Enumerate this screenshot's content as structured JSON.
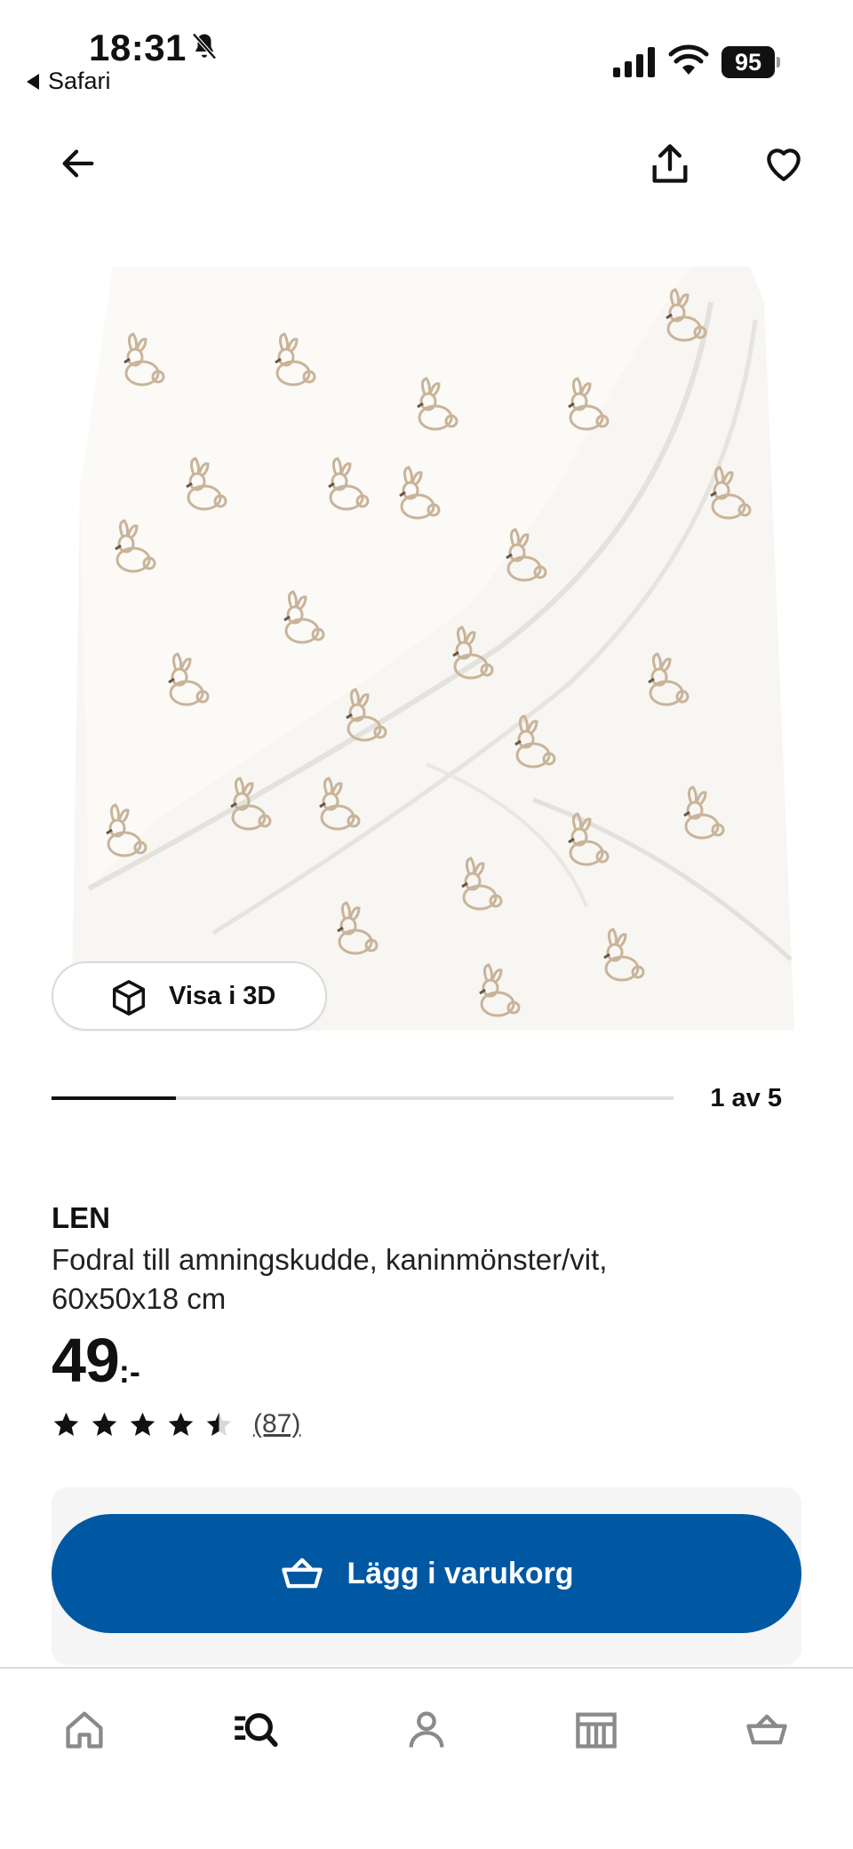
{
  "status_bar": {
    "time": "18:31",
    "back_app": "Safari",
    "battery": "95"
  },
  "nav": {
    "back_icon": "arrow-left-icon",
    "share_icon": "share-icon",
    "favorite_icon": "heart-icon"
  },
  "gallery": {
    "image_subject": "product-image",
    "view_3d_label": "Visa i 3D",
    "counter": "1 av 5",
    "progress_fraction": 0.2
  },
  "product": {
    "brand": "LEN",
    "description": "Fodral till amningskudde, kaninmönster/vit, 60x50x18 cm",
    "price": "49",
    "price_suffix": ":-",
    "rating": 4.5,
    "review_count": "(87)"
  },
  "cart": {
    "button_label": "Lägg i varukorg",
    "icon": "basket-icon"
  },
  "tab_bar": {
    "items": [
      {
        "name": "home",
        "icon": "home-icon",
        "active": false
      },
      {
        "name": "search",
        "icon": "search-icon",
        "active": true
      },
      {
        "name": "profile",
        "icon": "person-icon",
        "active": false
      },
      {
        "name": "store",
        "icon": "store-icon",
        "active": false
      },
      {
        "name": "cart",
        "icon": "basket-icon",
        "active": false
      }
    ]
  },
  "colors": {
    "primary_button": "#0058a3",
    "icon_inactive": "#8a8a8a",
    "icon_active": "#111111"
  }
}
